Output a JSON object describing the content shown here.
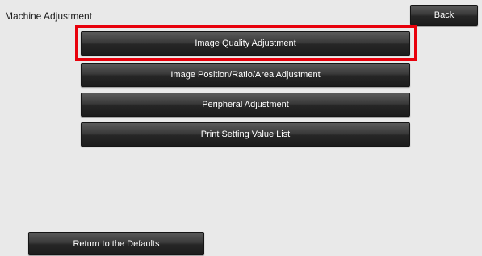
{
  "header": {
    "title": "Machine Adjustment",
    "back_label": "Back"
  },
  "menu": {
    "items": [
      {
        "label": "Image Quality Adjustment",
        "selected": true
      },
      {
        "label": "Image Position/Ratio/Area Adjustment",
        "selected": false
      },
      {
        "label": "Peripheral Adjustment",
        "selected": false
      },
      {
        "label": "Print Setting Value List",
        "selected": false
      }
    ]
  },
  "footer": {
    "defaults_label": "Return to the Defaults"
  },
  "colors": {
    "background": "#e9e9e9",
    "button_dark": "#2a2a2a",
    "highlight_red": "#e8000b",
    "button_text": "#ffffff"
  }
}
